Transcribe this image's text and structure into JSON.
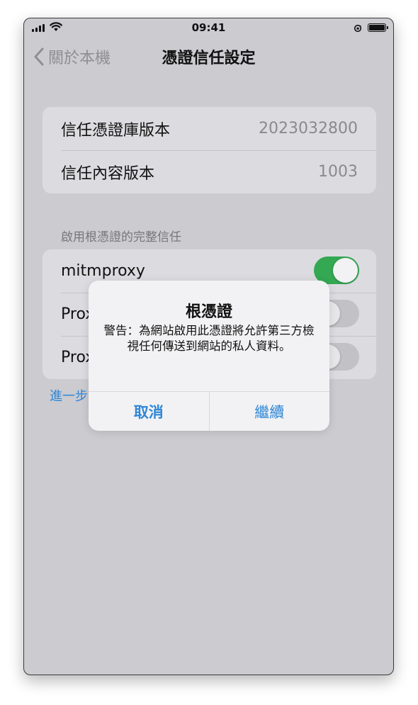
{
  "status_bar": {
    "time": "09:41",
    "icons": [
      "cellular-signal-icon",
      "wifi-icon",
      "orientation-lock-icon",
      "battery-icon"
    ]
  },
  "nav": {
    "back_label": "關於本機",
    "title": "憑證信任設定"
  },
  "info_rows": [
    {
      "label": "信任憑證庫版本",
      "value": "2023032800"
    },
    {
      "label": "信任內容版本",
      "value": "1003"
    }
  ],
  "trust_section": {
    "header": "啟用根憑證的完整信任",
    "items": [
      {
        "label": "mitmproxy",
        "enabled": true
      },
      {
        "label": "Prox",
        "enabled": false
      },
      {
        "label": "Prox",
        "enabled": false
      }
    ]
  },
  "more_link": "進一步",
  "alert": {
    "title": "根憑證",
    "message": "警告：為網站啟用此憑證將允許第三方檢視任何傳送到網站的私人資料。",
    "cancel_label": "取消",
    "continue_label": "繼續"
  },
  "colors": {
    "accent": "#2f86d6",
    "toggle_on": "#34a853",
    "dimmed_background": "#cbcbd0"
  }
}
